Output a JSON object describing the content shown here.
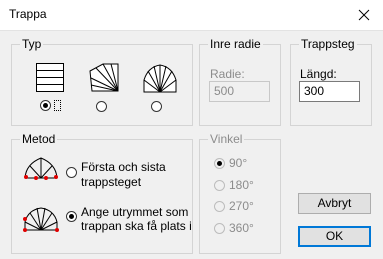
{
  "window": {
    "title": "Trappa",
    "close_icon": "close-icon"
  },
  "typ": {
    "label": "Typ",
    "options": [
      {
        "icon": "straight-stair-icon",
        "checked": true
      },
      {
        "icon": "quarter-turn-stair-icon",
        "checked": false
      },
      {
        "icon": "half-turn-stair-icon",
        "checked": false
      }
    ]
  },
  "inre_radie": {
    "label": "Inre radie",
    "radie_label": "Radie:",
    "radie_value": "500"
  },
  "trappsteg": {
    "label": "Trappsteg",
    "langd_label": "Längd:",
    "langd_value": "300"
  },
  "metod": {
    "label": "Metod",
    "options": [
      {
        "line1": "Första och sista",
        "line2": "trappsteget",
        "icon": "first-last-step-icon",
        "checked": false
      },
      {
        "line1": "Ange utrymmet som",
        "line2": "trappan ska få plats i",
        "icon": "space-fit-icon",
        "checked": true
      }
    ]
  },
  "vinkel": {
    "label": "Vinkel",
    "options": [
      "90°",
      "180°",
      "270°",
      "360°"
    ],
    "selected": "90°"
  },
  "buttons": {
    "cancel": "Avbryt",
    "ok": "OK"
  },
  "colors": {
    "focus_border": "#0078d7",
    "marker_red": "#e00000"
  }
}
